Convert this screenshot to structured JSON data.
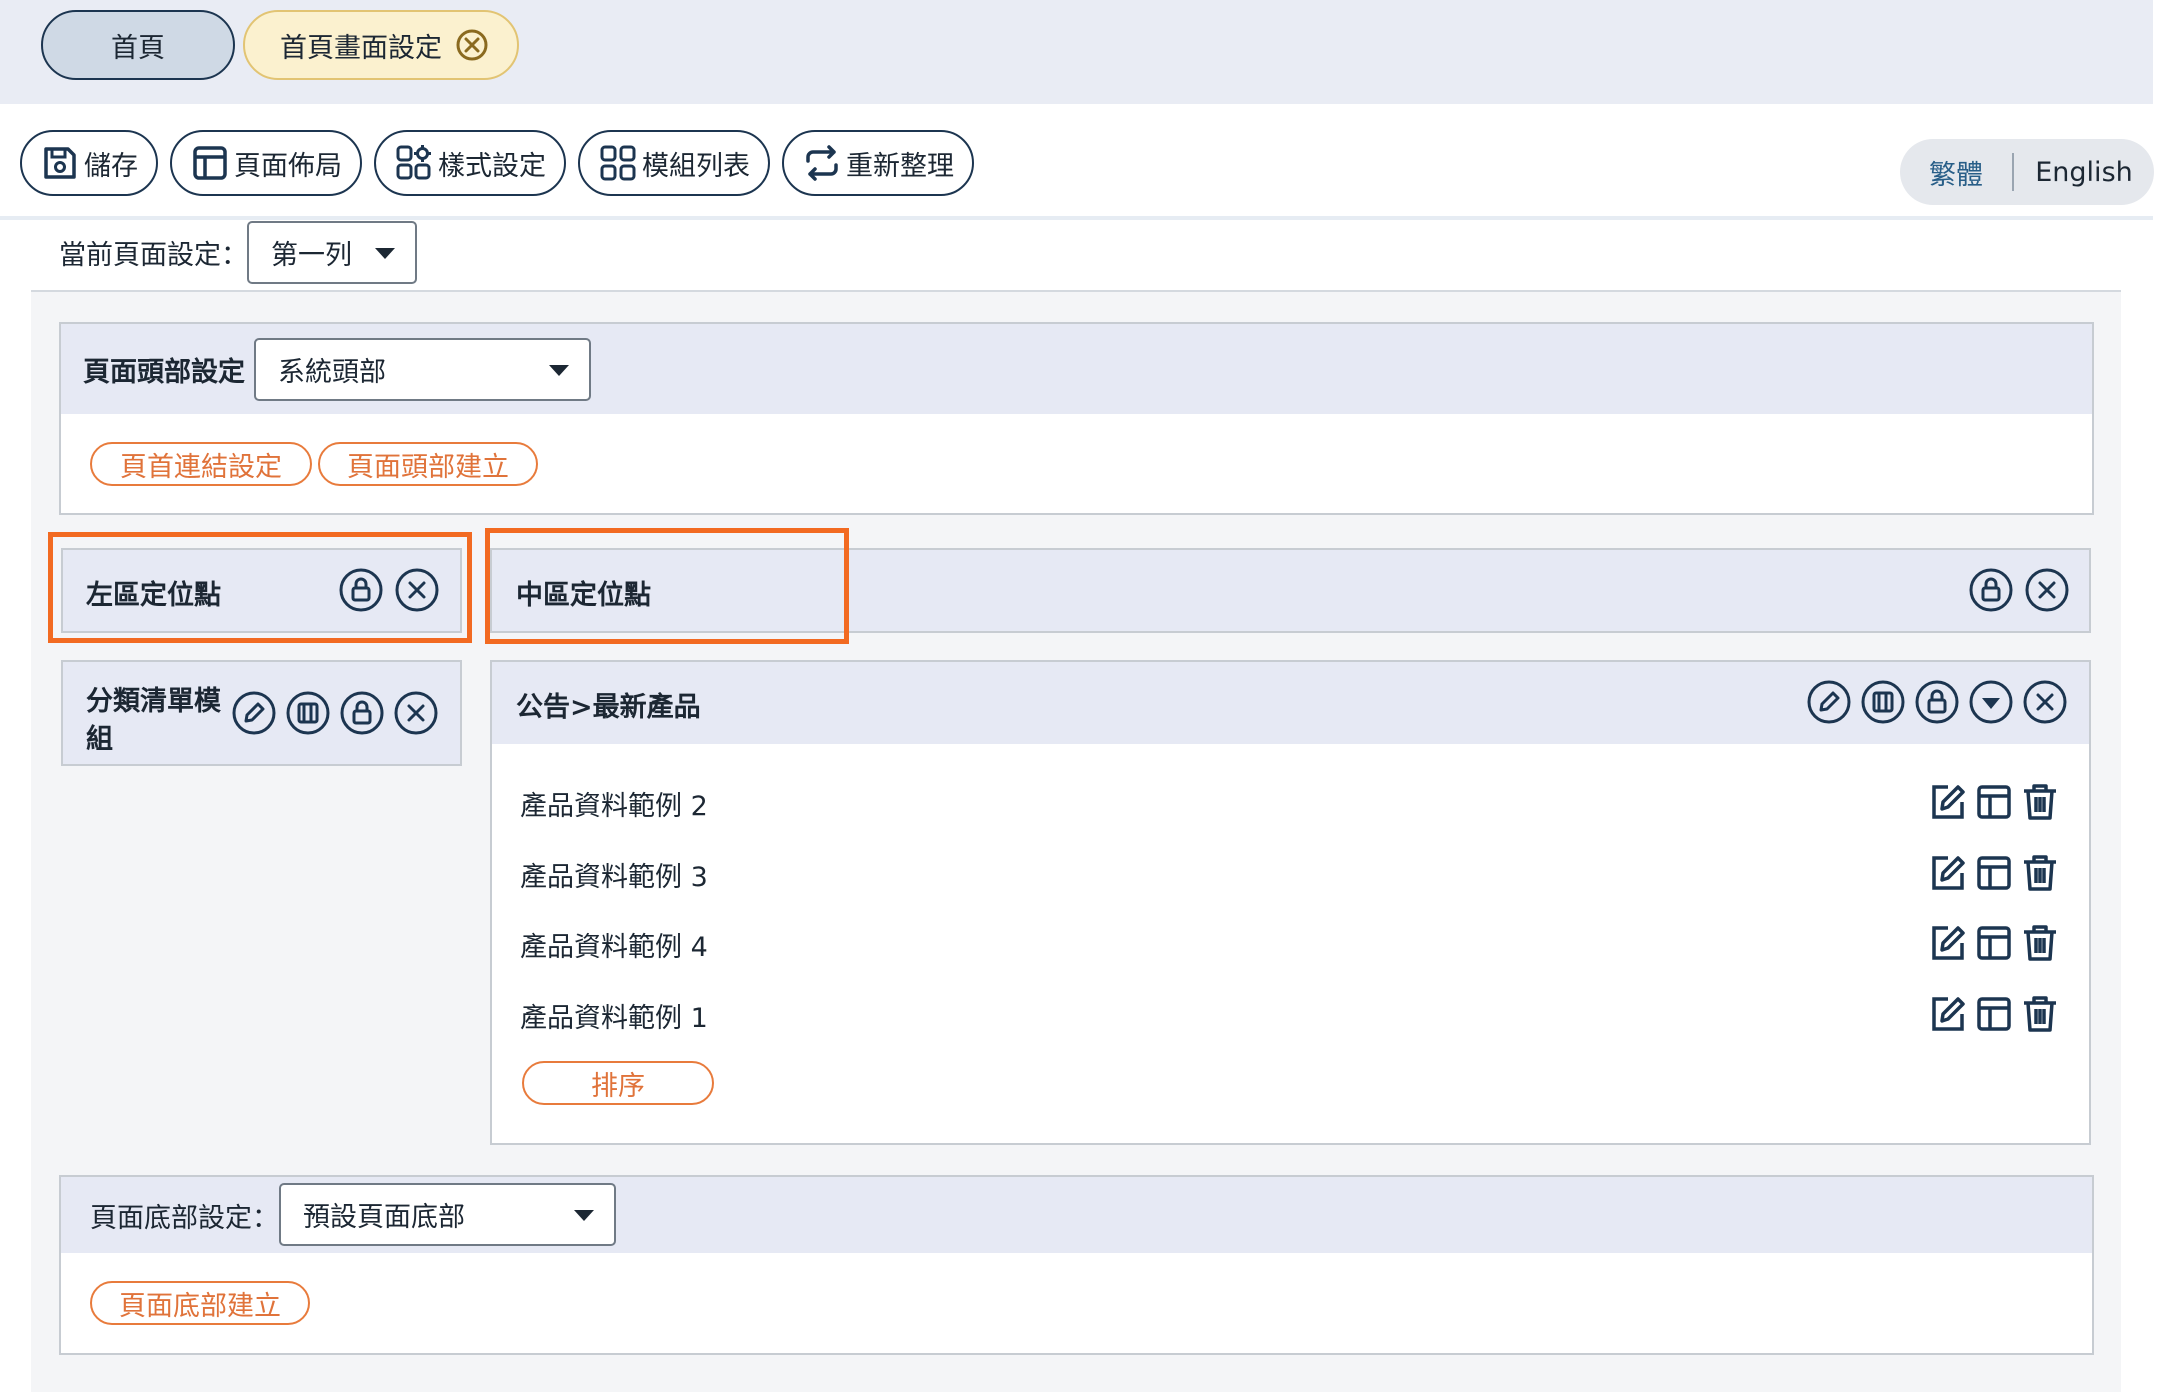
{
  "tabs": {
    "home": "首頁",
    "active": "首頁畫面設定"
  },
  "toolbar": {
    "save": "儲存",
    "layout": "頁面佈局",
    "style": "樣式設定",
    "modules": "模組列表",
    "refresh": "重新整理"
  },
  "lang": {
    "zh": "繁體",
    "en": "English"
  },
  "current": {
    "label": "當前頁面設定：",
    "value": "第一列"
  },
  "header_panel": {
    "label": "頁面頭部設定",
    "select": "系統頭部",
    "btn_links": "頁首連結設定",
    "btn_create": "頁面頭部建立"
  },
  "left_zone": {
    "title": "左區定位點"
  },
  "center_zone": {
    "title": "中區定位點"
  },
  "left_module": {
    "title_1": "分類清單模",
    "title_2": "組"
  },
  "center_module": {
    "title": "公告>最新產品",
    "items": [
      "產品資料範例 2",
      "產品資料範例 3",
      "產品資料範例 4",
      "產品資料範例 1"
    ],
    "sort": "排序"
  },
  "footer_panel": {
    "label": "頁面底部設定：",
    "select": "預設頁面底部",
    "btn_create": "頁面底部建立"
  },
  "colors": {
    "accent": "#f26a21",
    "navy": "#1c3550",
    "header_bg": "#e6e9f4",
    "tab_active": "#fbf1cf"
  }
}
